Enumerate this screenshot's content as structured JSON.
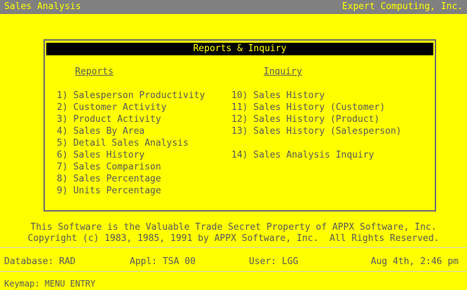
{
  "titlebar": {
    "app": "Sales Analysis",
    "company": "Expert Computing, Inc."
  },
  "menu": {
    "title": "Reports & Inquiry",
    "reports_heading": "Reports",
    "inquiry_heading": "Inquiry",
    "reports": [
      "1) Salesperson Productivity",
      "2) Customer Activity",
      "3) Product Activity",
      "4) Sales By Area",
      "5) Detail Sales Analysis",
      "6) Sales History",
      "7) Sales Comparison",
      "8) Sales Percentage",
      "9) Units Percentage"
    ],
    "inquiry": [
      "10) Sales History",
      "11) Sales History (Customer)",
      "12) Sales History (Product)",
      "13) Sales History (Salesperson)",
      "14) Sales Analysis Inquiry"
    ]
  },
  "notice": {
    "line1": "This Software is the Valuable Trade Secret Property of APPX Software, Inc.",
    "line2": "Copyright (c) 1983, 1985, 1991 by APPX Software, Inc.  All Rights Reserved."
  },
  "status": {
    "database": "Database: RAD",
    "appl": "Appl: TSA 00",
    "user": "User: LGG",
    "datetime": "Aug 4th, 2:46 pm"
  },
  "keymap": "Keymap: MENU ENTRY"
}
